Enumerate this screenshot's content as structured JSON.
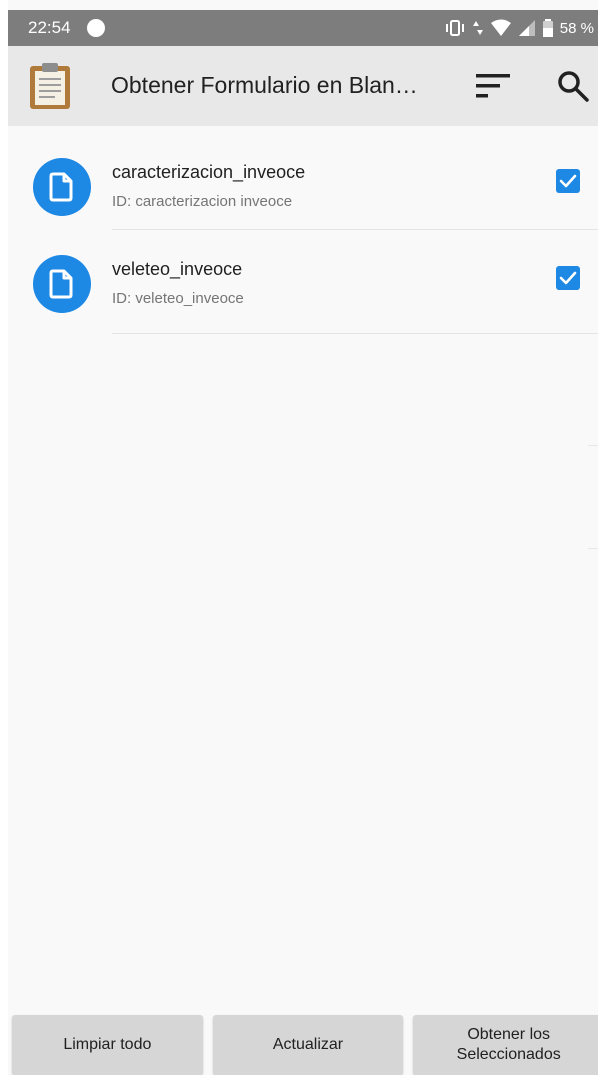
{
  "status_bar": {
    "time": "22:54",
    "battery": "58 %"
  },
  "app_bar": {
    "title": "Obtener Formulario en Blan…",
    "logo_icon": "clipboard-icon",
    "sort_icon": "sort-icon",
    "search_icon": "search-icon"
  },
  "forms": [
    {
      "name": "caracterizacion_inveoce",
      "id_text": "ID: caracterizacion inveoce",
      "checked": true
    },
    {
      "name": "veleteo_inveoce",
      "id_text": "ID: veleteo_inveoce",
      "checked": true
    }
  ],
  "buttons": {
    "clear_all": "Limpiar todo",
    "refresh": "Actualizar",
    "get_selected": "Obtener los\nSeleccionados"
  },
  "colors": {
    "accent": "#1e88e5",
    "app_bar": "#e8e8e8",
    "status_bar": "#7d7d7d",
    "button": "#d6d6d6"
  }
}
